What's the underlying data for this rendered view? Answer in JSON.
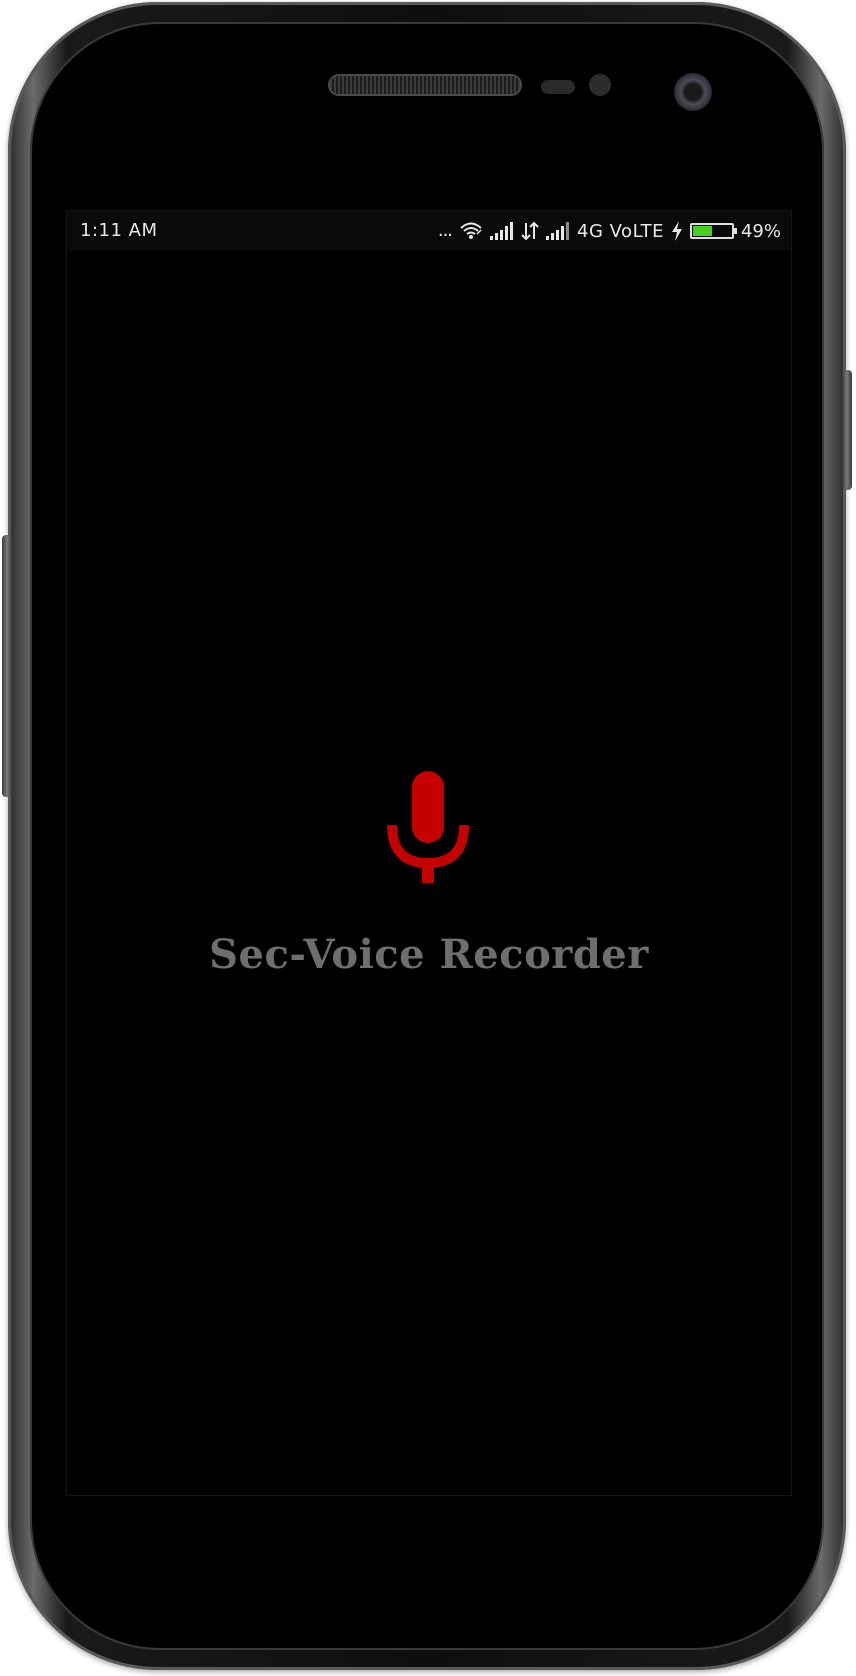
{
  "status_bar": {
    "time": "1:11 AM",
    "overflow": "...",
    "network": "4G VoLTE",
    "battery_percent": "49%",
    "battery_level": 0.49,
    "battery_color": "#43d01e"
  },
  "splash": {
    "icon": "microphone-icon",
    "icon_color": "#c40000",
    "title": "Sec-Voice Recorder",
    "title_color": "#6e6e6e"
  }
}
